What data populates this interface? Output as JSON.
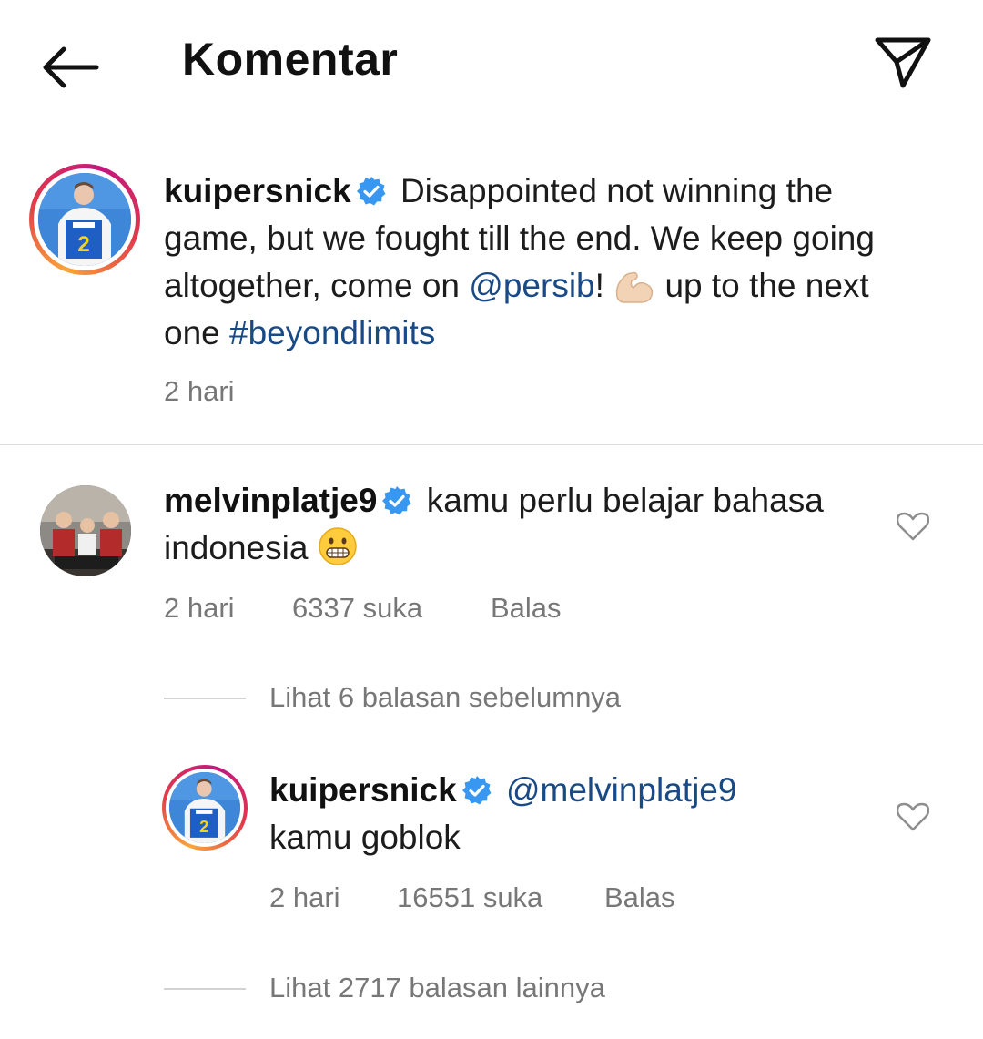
{
  "header": {
    "title": "Komentar"
  },
  "caption": {
    "username": "kuipersnick",
    "text_1": "Disappointed not winning the game, but we fought till the end. We keep going altogether, come on ",
    "mention": "@persib",
    "text_2": "! ",
    "emoji_name": "flexed-biceps-icon",
    "text_3": " up to the next one ",
    "hashtag": "#beyondlimits",
    "time": "2 hari"
  },
  "comment": {
    "username": "melvinplatje9",
    "text": "kamu perlu belajar bahasa indonesia ",
    "emoji_name": "grinning-face-icon",
    "time": "2 hari",
    "likes": "6337 suka",
    "reply_label": "Balas"
  },
  "view_previous": "Lihat 6 balasan sebelumnya",
  "reply": {
    "username": "kuipersnick",
    "mention": "@melvinplatje9",
    "text": "kamu goblok",
    "time": "2 hari",
    "likes": "16551 suka",
    "reply_label": "Balas"
  },
  "view_more": "Lihat 2717 balasan lainnya",
  "colors": {
    "link": "#1a4a86",
    "verified": "#3897f0",
    "meta": "#777777",
    "divider": "#dbdbdb"
  }
}
